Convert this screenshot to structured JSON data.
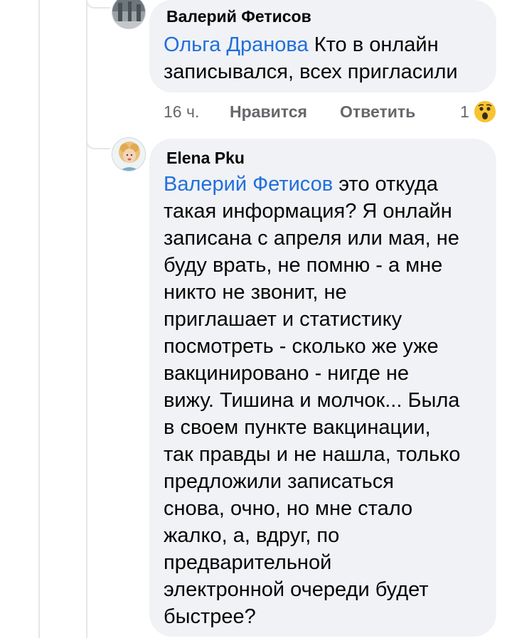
{
  "comments": [
    {
      "author": "Валерий Фетисов",
      "mention": "Ольга Дранова",
      "text_line1": "Кто в онлайн",
      "text_line2": "записывался, всех пригласили",
      "time": "16 ч.",
      "like_label": "Нравится",
      "reply_label": "Ответить",
      "reaction_count": "1",
      "reaction_icon": "wow-emoji-icon"
    },
    {
      "author": "Elena Pku",
      "mention": "Валерий Фетисов",
      "text_line1": "это откуда",
      "text_lines": [
        "такая информация? Я онлайн",
        "записана с апреля или мая, не",
        "буду врать, не помню - а мне",
        "никто не звонит, не",
        "приглашает и статистику",
        "посмотреть - сколько же уже",
        "вакцинировано - нигде не",
        "вижу. Тишина и молчок... Была",
        "в своем пункте вакцинации,",
        "так правды и не нашла, только",
        "предложили записаться",
        "снова, очно, но мне стало",
        "жалко, а, вдруг, по",
        "предварительной",
        "электронной очереди будет",
        "быстрее?"
      ]
    }
  ],
  "colors": {
    "bubble_bg": "#f0f2f5",
    "mention": "#216fdb",
    "meta_text": "#65676b",
    "reaction_yellow": "#f7c42f"
  }
}
